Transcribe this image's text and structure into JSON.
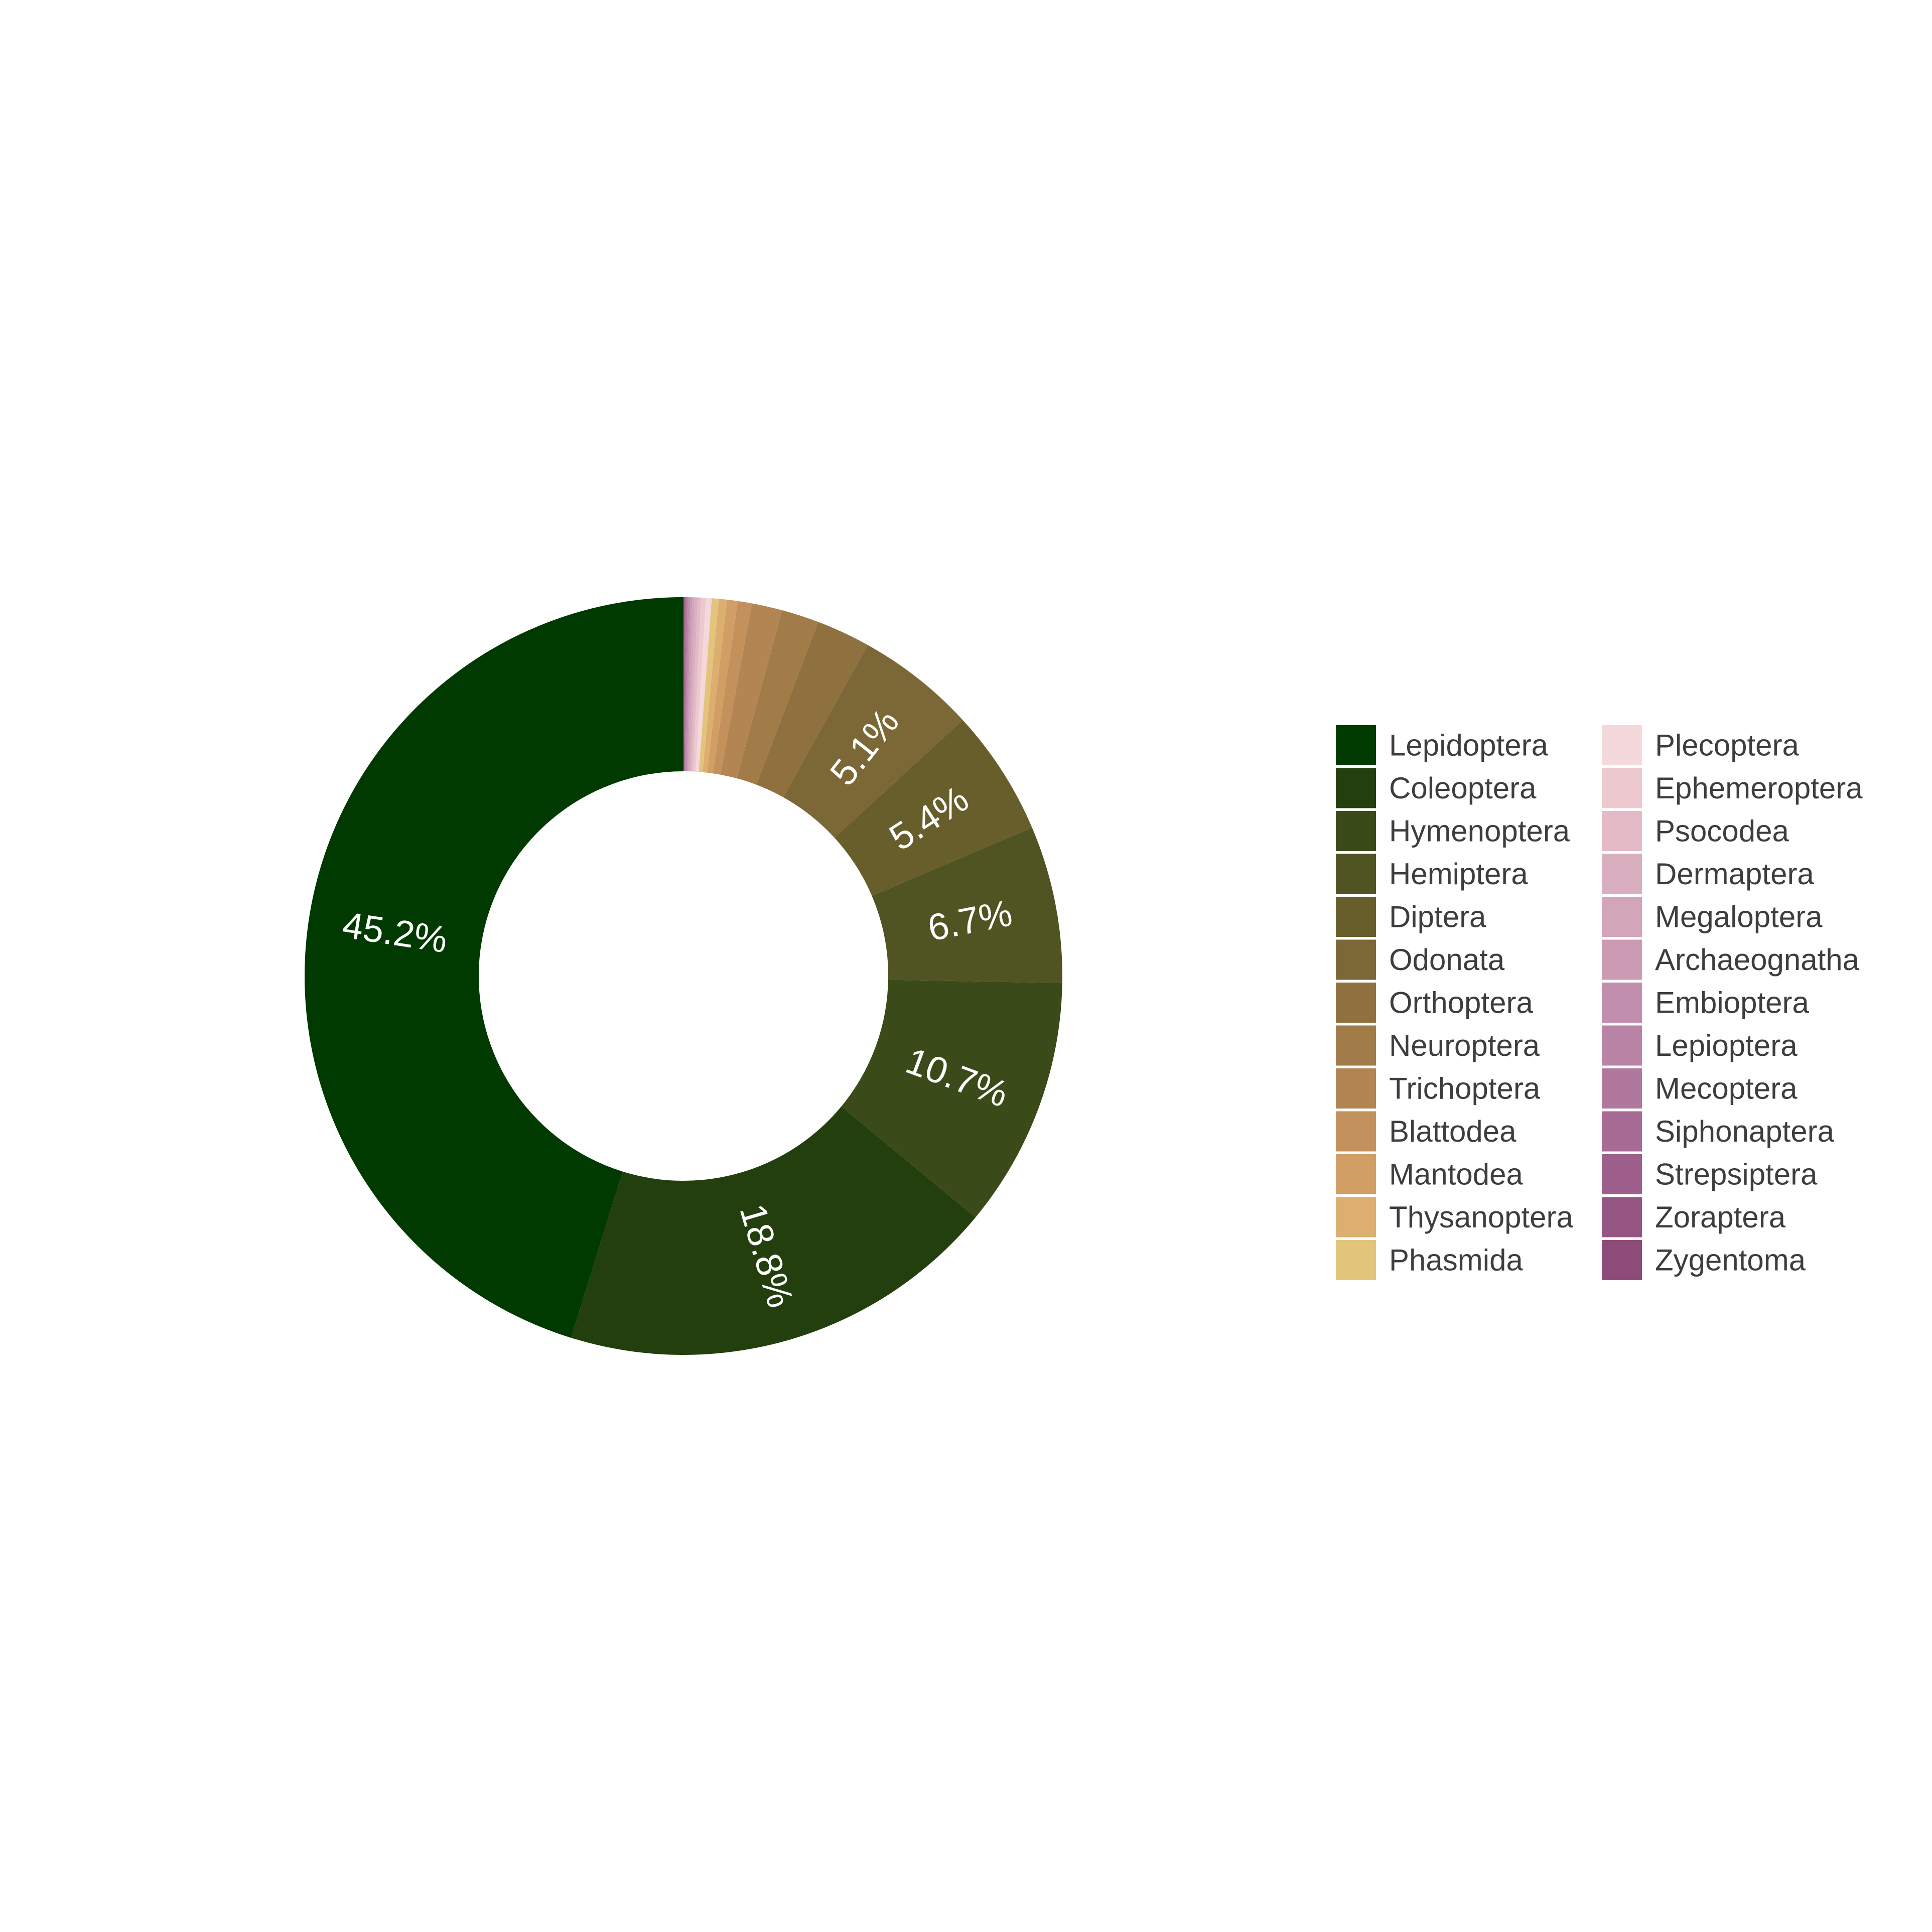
{
  "chart_data": {
    "type": "pie",
    "donut": true,
    "direction": "counterclockwise",
    "start": "top",
    "legend_position": "right",
    "legend_columns": 2,
    "slices": [
      {
        "name": "Lepidoptera",
        "value": 45.2,
        "label": "45.2%",
        "color": "#003a00"
      },
      {
        "name": "Coleoptera",
        "value": 18.8,
        "label": "18.8%",
        "color": "#233f0e"
      },
      {
        "name": "Hymenoptera",
        "value": 10.7,
        "label": "10.7%",
        "color": "#3b4a19"
      },
      {
        "name": "Hemiptera",
        "value": 6.7,
        "label": "6.7%",
        "color": "#4f5422"
      },
      {
        "name": "Diptera",
        "value": 5.4,
        "label": "5.4%",
        "color": "#675e2b"
      },
      {
        "name": "Odonata",
        "value": 5.1,
        "label": "5.1%",
        "color": "#7c6737"
      },
      {
        "name": "Orthoptera",
        "value": 2.3,
        "label": "",
        "color": "#8f7140"
      },
      {
        "name": "Neuroptera",
        "value": 1.6,
        "label": "",
        "color": "#a17b48"
      },
      {
        "name": "Trichoptera",
        "value": 1.3,
        "label": "",
        "color": "#b38552"
      },
      {
        "name": "Blattodea",
        "value": 0.6,
        "label": "",
        "color": "#c3915c"
      },
      {
        "name": "Mantodea",
        "value": 0.45,
        "label": "",
        "color": "#d19e66"
      },
      {
        "name": "Thysanoptera",
        "value": 0.35,
        "label": "",
        "color": "#dcae6f"
      },
      {
        "name": "Phasmida",
        "value": 0.3,
        "label": "",
        "color": "#e3c47b"
      },
      {
        "name": "Plecoptera",
        "value": 0.25,
        "label": "",
        "color": "#f5d8dc"
      },
      {
        "name": "Ephemeroptera",
        "value": 0.2,
        "label": "",
        "color": "#edc9cf"
      },
      {
        "name": "Psocodea",
        "value": 0.15,
        "label": "",
        "color": "#e3bac5"
      },
      {
        "name": "Dermaptera",
        "value": 0.12,
        "label": "",
        "color": "#d9afbf"
      },
      {
        "name": "Megaloptera",
        "value": 0.1,
        "label": "",
        "color": "#d3a5b9"
      },
      {
        "name": "Archaeognatha",
        "value": 0.08,
        "label": "",
        "color": "#cb9bb4"
      },
      {
        "name": "Embioptera",
        "value": 0.07,
        "label": "",
        "color": "#c28ead"
      },
      {
        "name": "Lepioptera",
        "value": 0.06,
        "label": "",
        "color": "#b983a6"
      },
      {
        "name": "Mecoptera",
        "value": 0.05,
        "label": "",
        "color": "#b1789e"
      },
      {
        "name": "Siphonaptera",
        "value": 0.04,
        "label": "",
        "color": "#a76b96"
      },
      {
        "name": "Strepsiptera",
        "value": 0.03,
        "label": "",
        "color": "#9e5f8c"
      },
      {
        "name": "Zoraptera",
        "value": 0.02,
        "label": "",
        "color": "#965683"
      },
      {
        "name": "Zygentoma",
        "value": 0.02,
        "label": "",
        "color": "#8e4b7a"
      }
    ]
  }
}
